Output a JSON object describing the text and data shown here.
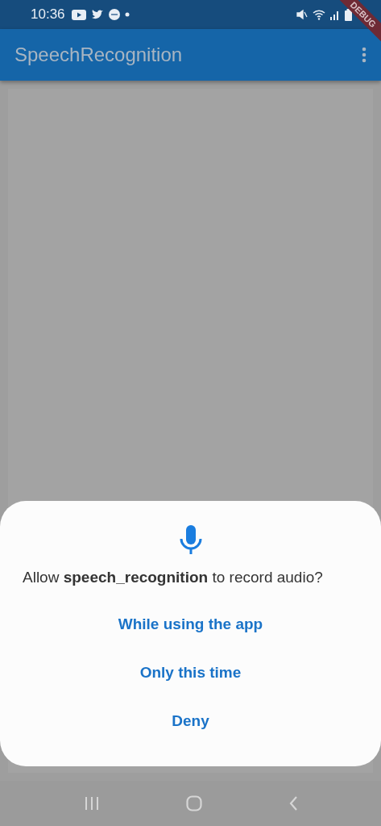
{
  "status_bar": {
    "time": "10:36"
  },
  "debug_banner": "DEBUG",
  "app_bar": {
    "title": "SpeechRecognition"
  },
  "dialog": {
    "message": "Allow **speech_recognition** to record audio?",
    "options": [
      {
        "label": "While using the app"
      },
      {
        "label": "Only this time"
      },
      {
        "label": "Deny"
      }
    ]
  }
}
